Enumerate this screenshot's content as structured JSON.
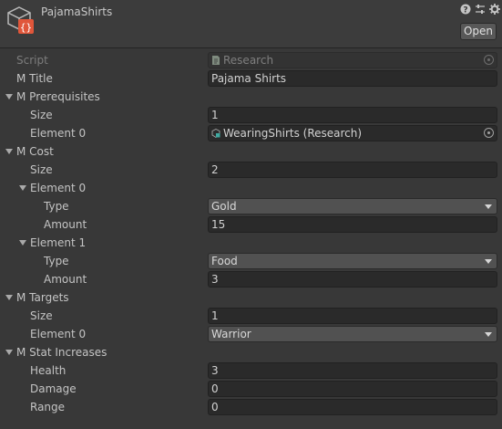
{
  "header": {
    "title": "PajamaShirts",
    "open_label": "Open"
  },
  "fields": {
    "script": {
      "label": "Script",
      "value": "Research"
    },
    "title": {
      "label": "M Title",
      "value": "Pajama Shirts"
    },
    "prereq": {
      "label": "M Prerequisites",
      "size_label": "Size",
      "size": "1",
      "element0_label": "Element 0",
      "element0_value": "WearingShirts (Research)"
    },
    "cost": {
      "label": "M Cost",
      "size_label": "Size",
      "size": "2",
      "e0": {
        "label": "Element 0",
        "type_label": "Type",
        "type": "Gold",
        "amount_label": "Amount",
        "amount": "15"
      },
      "e1": {
        "label": "Element 1",
        "type_label": "Type",
        "type": "Food",
        "amount_label": "Amount",
        "amount": "3"
      }
    },
    "targets": {
      "label": "M Targets",
      "size_label": "Size",
      "size": "1",
      "element0_label": "Element 0",
      "element0_value": "Warrior"
    },
    "stats": {
      "label": "M Stat Increases",
      "health_label": "Health",
      "health": "3",
      "damage_label": "Damage",
      "damage": "0",
      "range_label": "Range",
      "range": "0"
    }
  }
}
